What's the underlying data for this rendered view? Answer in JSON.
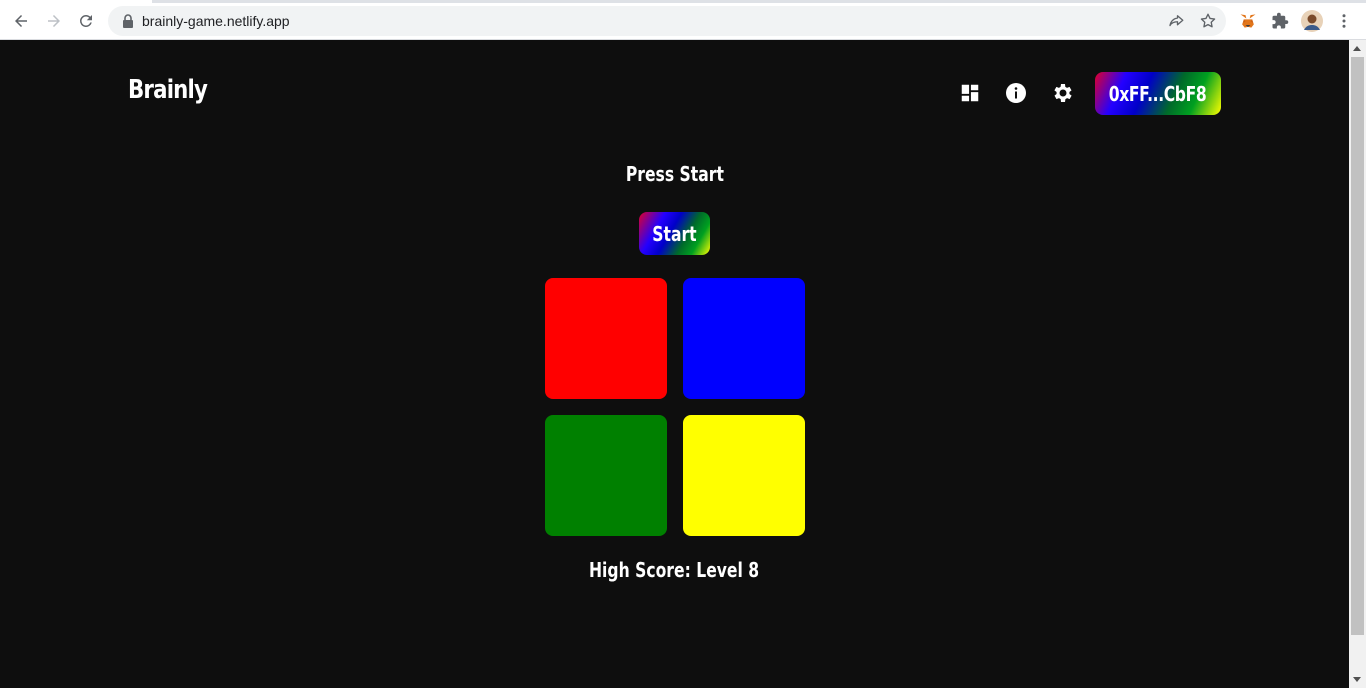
{
  "browser": {
    "url": "brainly-game.netlify.app",
    "icons": [
      "back-icon",
      "forward-icon",
      "reload-icon",
      "lock-icon",
      "share-icon",
      "bookmark-star-icon",
      "metamask-fox-icon",
      "extensions-puzzle-icon",
      "profile-avatar",
      "more-menu-icon"
    ]
  },
  "header": {
    "logo": "Brainly",
    "icons": [
      "dashboard-icon",
      "info-icon",
      "settings-gear-icon"
    ],
    "wallet_label": "0xFF...CbF8"
  },
  "game": {
    "status": "Press Start",
    "start_label": "Start",
    "pads": [
      {
        "name": "red-pad",
        "color": "#ff0000"
      },
      {
        "name": "blue-pad",
        "color": "#0000ff"
      },
      {
        "name": "green-pad",
        "color": "#008000"
      },
      {
        "name": "yellow-pad",
        "color": "#ffff00"
      }
    ],
    "high_score": "High Score: Level 8"
  },
  "colors": {
    "background": "#0e0e0e",
    "text": "#ffffff"
  }
}
